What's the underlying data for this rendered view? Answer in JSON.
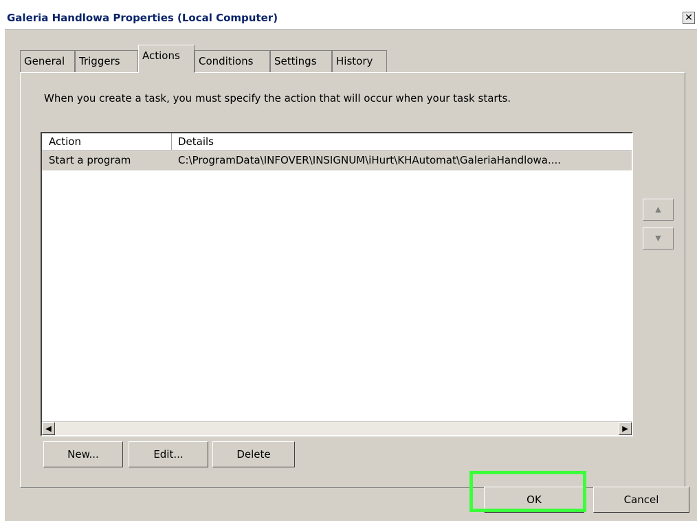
{
  "window": {
    "title": "Galeria Handlowa Properties (Local Computer)",
    "close_glyph": "✕"
  },
  "tabs": [
    {
      "label": "General"
    },
    {
      "label": "Triggers"
    },
    {
      "label": "Actions",
      "active": true
    },
    {
      "label": "Conditions"
    },
    {
      "label": "Settings"
    },
    {
      "label": "History"
    }
  ],
  "panel": {
    "description": "When you create a task, you must specify the action that will occur when your task starts."
  },
  "list": {
    "columns": [
      "Action",
      "Details"
    ],
    "rows": [
      {
        "action": "Start a program",
        "details": "C:\\ProgramData\\INFOVER\\INSIGNUM\\iHurt\\KHAutomat\\GaleriaHandlowa...."
      }
    ],
    "scroll_left_glyph": "◀",
    "scroll_right_glyph": "▶"
  },
  "side_buttons": {
    "up_glyph": "▲",
    "down_glyph": "▼"
  },
  "buttons": {
    "new": "New...",
    "edit": "Edit...",
    "delete": "Delete",
    "ok": "OK",
    "cancel": "Cancel"
  },
  "colors": {
    "highlight": "#3cff3c",
    "title_text": "#0a246a"
  }
}
